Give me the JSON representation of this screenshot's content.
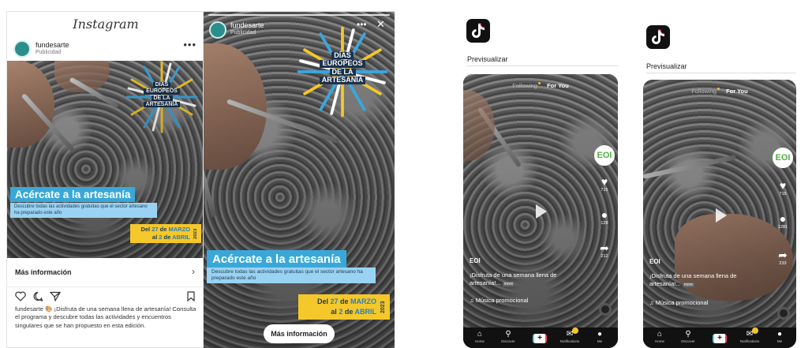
{
  "instagram_feed": {
    "logo": "Instagram",
    "username": "fundesarte",
    "subtitle": "Publicidad",
    "menu_icon": "more-dots-icon",
    "badge_lines": [
      "DÍAS",
      "EUROPEOS",
      "DE LA",
      "ARTESANÍA"
    ],
    "headline": "Acércate a la artesanía",
    "subheadline": "Descubre todas las actividades gratuitas que el sector artesano ha preparado este año",
    "date_line1_prefix": "Del ",
    "date_line1_day": "27",
    "date_line1_mid": " de ",
    "date_line1_month": "MARZO",
    "date_line2_prefix": "al ",
    "date_line2_day": "2",
    "date_line2_mid": " de ",
    "date_line2_month": "ABRIL",
    "year": "2023",
    "cta_label": "Más información",
    "caption": "fundesarte 🎨 ¡Disfruta de una semana llena de artesanía! Consulta el programa y descubre todas las actividades y encuentros singulares que se han propuesto en esta edición."
  },
  "instagram_story": {
    "username": "fundesarte",
    "subtitle": "Publicidad",
    "badge_lines": [
      "DÍAS",
      "EUROPEOS",
      "DE LA",
      "ARTESANÍA"
    ],
    "headline": "Acércate a la artesanía",
    "subheadline": "Descubre todas las actividades gratuitas que el sector artesano ha preparado este año",
    "date_line1_prefix": "Del ",
    "date_line1_day": "27",
    "date_line1_mid": " de ",
    "date_line1_month": "MARZO",
    "date_line2_prefix": "al ",
    "date_line2_day": "2",
    "date_line2_mid": " de ",
    "date_line2_month": "ABRIL",
    "year": "2023",
    "cta_label": "Más información"
  },
  "tiktok_1": {
    "preview_label": "Previsualizar",
    "tab_following": "Following",
    "tab_foryou": "For You",
    "brand_avatar": "EOI",
    "likes": "715",
    "comments": "128",
    "shares": "212",
    "username": "EOI",
    "description": "¡Disfruta de una semana llena de artesanía!...",
    "more_tag": "more",
    "music": "♫ Música promocional",
    "nav": [
      "Home",
      "Discover",
      "",
      "Notifications",
      "Me"
    ]
  },
  "tiktok_2": {
    "preview_label": "Previsualizar",
    "tab_following": "Following",
    "tab_foryou": "For You",
    "brand_avatar": "EOI",
    "likes": "715",
    "comments": "1281",
    "shares": "233",
    "username": "EOI",
    "description": "¡Disfruta de una semana llena de artesanía!...",
    "more_tag": "more",
    "music": "♫ Música promocional",
    "nav": [
      "Home",
      "Discover",
      "",
      "Notifications",
      "Me"
    ]
  },
  "colors": {
    "banner_blue": "#39a8d8",
    "banner_light": "#9ad3f1",
    "date_yellow": "#f4c82a",
    "tiktok_black": "#111111",
    "eoi_green": "#4fb043"
  }
}
